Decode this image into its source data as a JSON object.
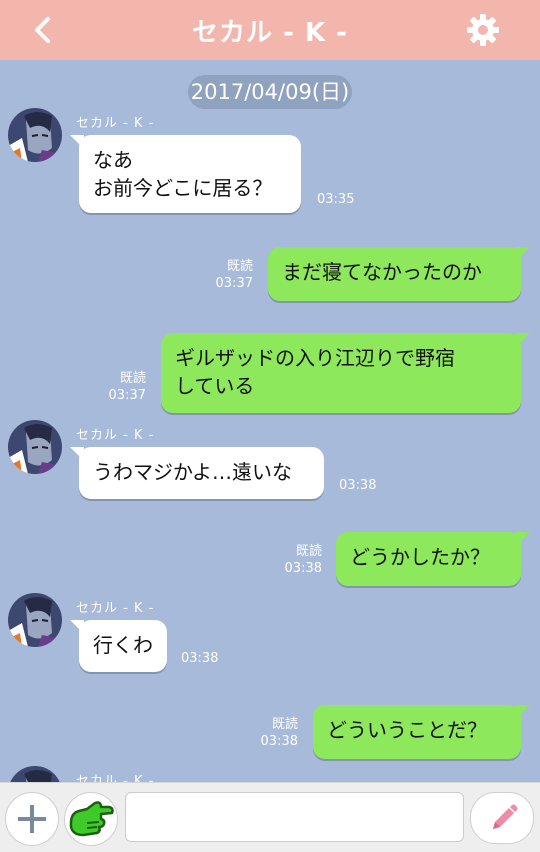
{
  "header": {
    "title": "セカル - K -",
    "back_icon": "chevron-left-icon",
    "settings_icon": "gear-icon",
    "background": "#f3b6ac"
  },
  "chat": {
    "date": "2017/04/09(日)",
    "background": "#a7bad9",
    "messages": [
      {
        "side": "in",
        "sender": "セカル - K -",
        "text": "なあ\nお前今どこに居る？",
        "time": "03:35"
      },
      {
        "side": "out",
        "read": "既読",
        "text": "まだ寝てなかったのか",
        "time": "03:37"
      },
      {
        "side": "out",
        "read": "既読",
        "text": "ギルザッドの入り江辺りで野宿\nしている",
        "time": "03:37"
      },
      {
        "side": "in",
        "sender": "セカル - K -",
        "text": "うわマジかよ…遠いな",
        "time": "03:38"
      },
      {
        "side": "out",
        "read": "既読",
        "text": "どうかしたか？",
        "time": "03:38"
      },
      {
        "side": "in",
        "sender": "セカル - K -",
        "text": "行くわ",
        "time": "03:38"
      },
      {
        "side": "out",
        "read": "既読",
        "text": "どういうことだ？",
        "time": "03:38"
      },
      {
        "side": "in",
        "sender": "セカル - K -",
        "text": "",
        "time": ""
      }
    ]
  },
  "inputbar": {
    "add_icon": "plus-icon",
    "stamp_icon": "pointing-hand-icon",
    "message_value": "",
    "send_icon": "pencil-icon"
  },
  "colors": {
    "outgoing_bubble": "#8de85b",
    "incoming_bubble": "#ffffff"
  }
}
